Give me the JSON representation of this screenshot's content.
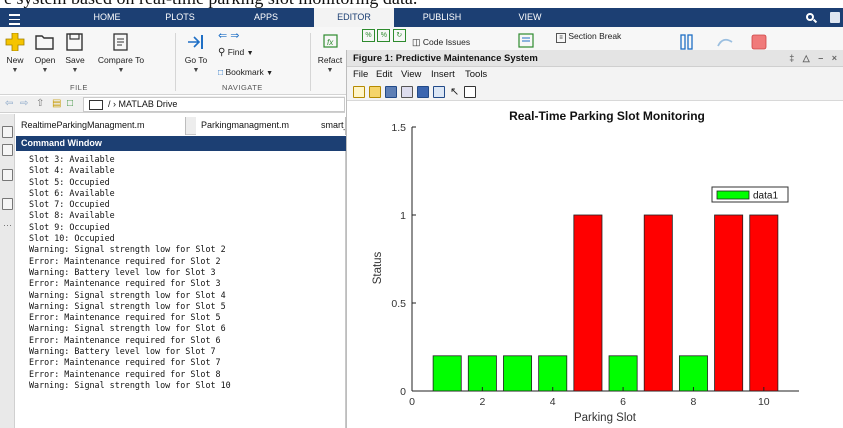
{
  "caption": "e system based on real-time parking slot monitoring data.",
  "tabs": [
    "HOME",
    "PLOTS",
    "APPS",
    "EDITOR",
    "PUBLISH",
    "VIEW"
  ],
  "active_tab": "EDITOR",
  "toolstrip": {
    "new": "New",
    "open": "Open",
    "save": "Save",
    "compare": "Compare To",
    "goto": "Go To",
    "find": "Find",
    "bookmark": "Bookmark",
    "refactor": "Refact",
    "code_issues": "Code Issues",
    "section_break": "Section Break",
    "file_section": "FILE",
    "navigate_section": "NAVIGATE"
  },
  "address": {
    "path": "/ › MATLAB Drive"
  },
  "editor_tabs": [
    "RealtimeParkingManagment.m",
    "Parkingmanagment.m",
    "smart_"
  ],
  "command_window": {
    "title": "Command Window",
    "lines": [
      "Slot 3: Available",
      "Slot 4: Available",
      "Slot 5: Occupied",
      "Slot 6: Available",
      "Slot 7: Occupied",
      "Slot 8: Available",
      "Slot 9: Occupied",
      "Slot 10: Occupied",
      "Warning: Signal strength low for Slot 2",
      "Error: Maintenance required for Slot 2",
      "Warning: Battery level low for Slot 3",
      "Error: Maintenance required for Slot 3",
      "Warning: Signal strength low for Slot 4",
      "Warning: Signal strength low for Slot 5",
      "Error: Maintenance required for Slot 5",
      "Warning: Signal strength low for Slot 6",
      "Error: Maintenance required for Slot 6",
      "Warning: Battery level low for Slot 7",
      "Error: Maintenance required for Slot 7",
      "Error: Maintenance required for Slot 8",
      "Warning: Signal strength low for Slot 10"
    ]
  },
  "figure": {
    "title": "Figure 1: Predictive Maintenance System",
    "window_controls": "‡ △ – ×",
    "menu": [
      "File",
      "Edit",
      "View",
      "Insert",
      "Tools"
    ]
  },
  "colors": {
    "accent": "#1c3f73",
    "available": "#00ff00",
    "occupied": "#ff0000"
  },
  "chart_data": {
    "type": "bar",
    "title": "Real-Time Parking Slot Monitoring",
    "xlabel": "Parking Slot",
    "ylabel": "Status",
    "x": [
      1,
      2,
      3,
      4,
      5,
      6,
      7,
      8,
      9,
      10
    ],
    "values": [
      0.2,
      0.2,
      0.2,
      0.2,
      1,
      0.2,
      1,
      0.2,
      1,
      1
    ],
    "bar_colors": [
      "#00ff00",
      "#00ff00",
      "#00ff00",
      "#00ff00",
      "#ff0000",
      "#00ff00",
      "#ff0000",
      "#00ff00",
      "#ff0000",
      "#ff0000"
    ],
    "xlim": [
      0,
      11
    ],
    "ylim": [
      0,
      1.5
    ],
    "xticks": [
      0,
      2,
      4,
      6,
      8,
      10
    ],
    "yticks": [
      0,
      0.5,
      1,
      1.5
    ],
    "ytick_labels": [
      "0",
      "0.5",
      "1",
      "1.5"
    ],
    "legend": [
      "data1"
    ],
    "legend_position": "top-right",
    "grid": false
  }
}
